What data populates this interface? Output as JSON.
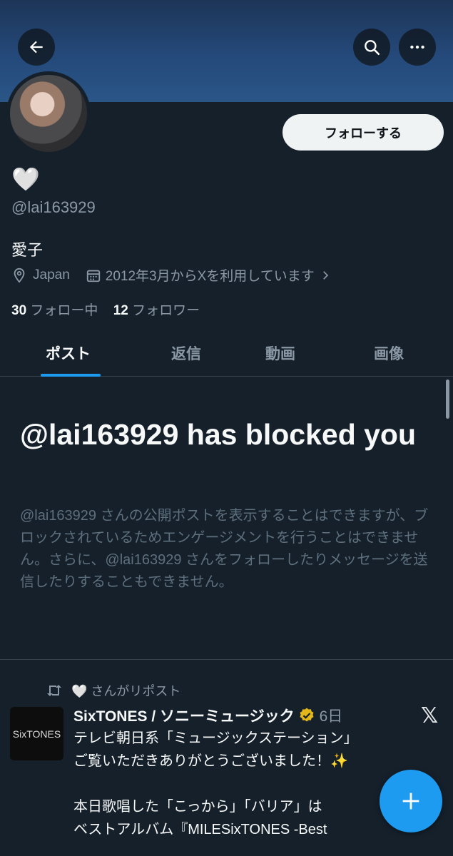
{
  "colors": {
    "background": "#15202b",
    "accent": "#1d9bf0",
    "secondary_text": "#8b98a5",
    "muted_text": "#5e6f7d"
  },
  "header": {
    "back_icon": "arrow-left-icon",
    "search_icon": "search-icon",
    "more_icon": "more-horizontal-icon"
  },
  "profile": {
    "display_name_emoji": "🤍",
    "handle": "@lai163929",
    "bio": "愛子",
    "location": "Japan",
    "joined": "2012年3月からXを利用しています",
    "following_count": "30",
    "following_label": "フォロー中",
    "followers_count": "12",
    "followers_label": "フォロワー",
    "follow_button": "フォローする"
  },
  "tabs": [
    {
      "label": "ポスト",
      "active": true
    },
    {
      "label": "返信",
      "active": false
    },
    {
      "label": "動画",
      "active": false
    },
    {
      "label": "画像",
      "active": false
    }
  ],
  "blocked": {
    "title": "@lai163929 has blocked you",
    "description": "@lai163929 さんの公開ポストを表示することはできますが、ブロックされているためエンゲージメントを行うことはできません。さらに、@lai163929 さんをフォローしたりメッセージを送信したりすることもできません。"
  },
  "post": {
    "repost_by": "🤍 さんがリポスト",
    "avatar_text": "SixTONES",
    "author": "SixTONES / ソニーミュージック",
    "verified_icon": "verified-badge-icon",
    "time": "6日",
    "body": "テレビ朝日系「ミュージックステーション」\nご覧いただきありがとうございました！✨\n\n本日歌唱した「こっから」「バリア」は\nベストアルバム『MILESixTONES -Best"
  },
  "fab_icon": "plus-icon"
}
